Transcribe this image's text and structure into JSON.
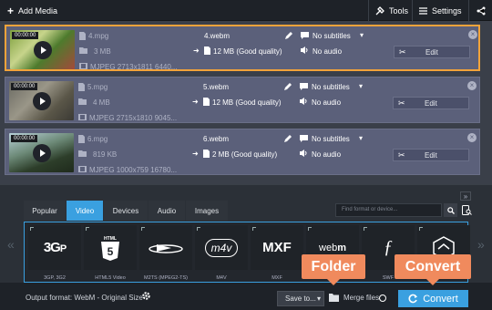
{
  "topbar": {
    "add_media": "Add Media",
    "tools": "Tools",
    "settings": "Settings"
  },
  "files": [
    {
      "duration": "00:00:00",
      "source_name": "4.mpg",
      "source_size": "3 MB",
      "source_codec": "MJPEG 2713x1811 6440...",
      "output_name": "4.webm",
      "output_size": "12 MB (Good quality)",
      "subtitles": "No subtitles",
      "audio": "No audio",
      "edit": "Edit"
    },
    {
      "duration": "00:00:00",
      "source_name": "5.mpg",
      "source_size": "4 MB",
      "source_codec": "MJPEG 2715x1810 9045...",
      "output_name": "5.webm",
      "output_size": "12 MB (Good quality)",
      "subtitles": "No subtitles",
      "audio": "No audio",
      "edit": "Edit"
    },
    {
      "duration": "00:00:00",
      "source_name": "6.mpg",
      "source_size": "819 KB",
      "source_codec": "MJPEG 1000x759 16780...",
      "output_name": "6.webm",
      "output_size": "2 MB (Good quality)",
      "subtitles": "No subtitles",
      "audio": "No audio",
      "edit": "Edit"
    }
  ],
  "tabs": [
    "Popular",
    "Video",
    "Devices",
    "Audio",
    "Images"
  ],
  "active_tab": "Video",
  "search_placeholder": "Find format or device...",
  "formats": [
    {
      "label": "3GP, 3G2",
      "logo": "3GP"
    },
    {
      "label": "HTML5 Video",
      "logo": "HTML5"
    },
    {
      "label": "M2TS (MPEG2-TS)",
      "logo": "Blu-ray"
    },
    {
      "label": "M4V",
      "logo": "m4v"
    },
    {
      "label": "MXF",
      "logo": "MXF"
    },
    {
      "label": "WebM",
      "logo": "webm"
    },
    {
      "label": "SWF",
      "logo": "flash"
    },
    {
      "label": "",
      "logo": "shield"
    }
  ],
  "bottombar": {
    "output_format": "Output format: WebM - Original Size",
    "save_to": "Save to...",
    "merge_files": "Merge files:",
    "convert": "Convert"
  },
  "callouts": {
    "folder": "Folder",
    "convert": "Convert"
  },
  "colors": {
    "accent": "#3aa0e0",
    "selection": "#f2a33a",
    "callout": "#f08a5d"
  }
}
